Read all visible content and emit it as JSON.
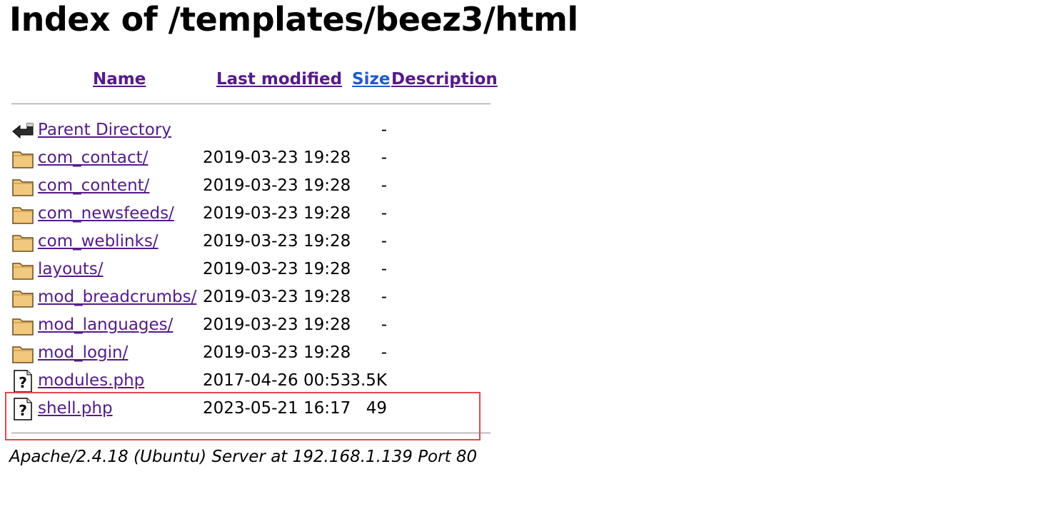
{
  "page": {
    "title": "Index of /templates/beez3/html"
  },
  "table": {
    "headers": {
      "name": "Name",
      "last_modified": "Last modified",
      "size": "Size",
      "description": "Description"
    },
    "rows": [
      {
        "icon": "back-arrow-icon",
        "name": "Parent Directory",
        "modified": "",
        "size": "-"
      },
      {
        "icon": "folder-icon",
        "name": "com_contact/",
        "modified": "2019-03-23 19:28",
        "size": "-"
      },
      {
        "icon": "folder-icon",
        "name": "com_content/",
        "modified": "2019-03-23 19:28",
        "size": "-"
      },
      {
        "icon": "folder-icon",
        "name": "com_newsfeeds/",
        "modified": "2019-03-23 19:28",
        "size": "-"
      },
      {
        "icon": "folder-icon",
        "name": "com_weblinks/",
        "modified": "2019-03-23 19:28",
        "size": "-"
      },
      {
        "icon": "folder-icon",
        "name": "layouts/",
        "modified": "2019-03-23 19:28",
        "size": "-"
      },
      {
        "icon": "folder-icon",
        "name": "mod_breadcrumbs/",
        "modified": "2019-03-23 19:28",
        "size": "-"
      },
      {
        "icon": "folder-icon",
        "name": "mod_languages/",
        "modified": "2019-03-23 19:28",
        "size": "-"
      },
      {
        "icon": "folder-icon",
        "name": "mod_login/",
        "modified": "2019-03-23 19:28",
        "size": "-"
      },
      {
        "icon": "unknown-file-icon",
        "name": "modules.php",
        "modified": "2017-04-26 00:53",
        "size": "3.5K"
      },
      {
        "icon": "unknown-file-icon",
        "name": "shell.php",
        "modified": "2023-05-21 16:17",
        "size": "49"
      }
    ]
  },
  "footer": {
    "address": "Apache/2.4.18 (Ubuntu) Server at 192.168.1.139 Port 80"
  },
  "annotation": {
    "highlight_color": "#e5484d"
  }
}
